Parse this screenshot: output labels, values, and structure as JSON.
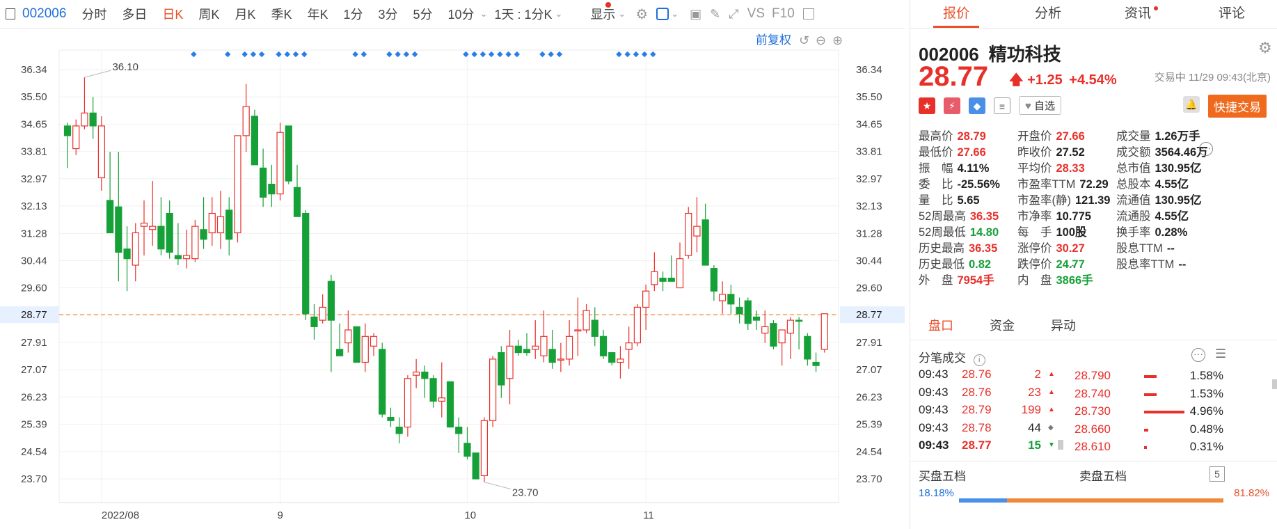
{
  "toolbar": {
    "code": "002006",
    "items": [
      "分时",
      "多日",
      "日K",
      "周K",
      "月K",
      "季K",
      "年K",
      "1分",
      "3分",
      "5分",
      "10分"
    ],
    "selected": "日K",
    "period_select": "1天 : 1分K",
    "display_select": "显示",
    "vs_label": "VS",
    "f10_label": "F10"
  },
  "chart": {
    "restore_label": "前复权",
    "y_ticks": [
      "36.34",
      "35.50",
      "34.65",
      "33.81",
      "32.97",
      "32.13",
      "31.28",
      "30.44",
      "29.60",
      "28.77",
      "27.91",
      "27.07",
      "26.23",
      "25.39",
      "24.54",
      "23.70"
    ],
    "y_current": "28.77",
    "x_labels": [
      "2022/08",
      "9",
      "10",
      "11"
    ],
    "high_label": "36.10",
    "low_label": "23.70"
  },
  "chart_data": {
    "type": "candlestick",
    "ylim": [
      23.7,
      36.34
    ],
    "current_price": 28.77,
    "candles": [
      [
        34.3,
        34.7,
        33.3,
        34.6,
        0
      ],
      [
        34.6,
        34.8,
        33.7,
        33.9,
        1
      ],
      [
        34.6,
        36.1,
        34.5,
        35.0,
        1
      ],
      [
        35.0,
        35.5,
        34.2,
        34.6,
        0
      ],
      [
        34.6,
        34.9,
        32.6,
        33.0,
        1
      ],
      [
        32.3,
        33.8,
        31.3,
        31.3,
        0
      ],
      [
        32.1,
        33.8,
        29.8,
        30.7,
        0
      ],
      [
        30.8,
        31.5,
        29.5,
        30.5,
        0
      ],
      [
        30.3,
        31.6,
        29.8,
        31.3,
        1
      ],
      [
        31.5,
        32.3,
        30.6,
        31.6,
        1
      ],
      [
        31.4,
        32.9,
        30.9,
        31.5,
        1
      ],
      [
        31.5,
        32.4,
        30.6,
        30.8,
        0
      ],
      [
        31.9,
        32.3,
        30.5,
        30.7,
        0
      ],
      [
        30.6,
        31.6,
        30.3,
        30.5,
        0
      ],
      [
        30.5,
        31.4,
        30.2,
        30.6,
        1
      ],
      [
        30.5,
        31.7,
        30.4,
        31.5,
        1
      ],
      [
        31.4,
        32.4,
        30.8,
        31.1,
        0
      ],
      [
        31.3,
        32.4,
        30.9,
        31.9,
        1
      ],
      [
        31.3,
        32.6,
        30.8,
        31.8,
        1
      ],
      [
        32.0,
        32.4,
        30.6,
        31.1,
        0
      ],
      [
        31.3,
        34.0,
        31.0,
        34.3,
        1
      ],
      [
        34.3,
        35.9,
        33.8,
        35.2,
        1
      ],
      [
        34.9,
        35.1,
        33.4,
        33.4,
        0
      ],
      [
        33.3,
        33.9,
        32.1,
        32.4,
        0
      ],
      [
        32.8,
        33.4,
        32.1,
        32.5,
        0
      ],
      [
        32.5,
        34.7,
        32.3,
        34.4,
        1
      ],
      [
        34.6,
        34.6,
        32.8,
        32.9,
        0
      ],
      [
        32.7,
        33.4,
        32.0,
        31.8,
        0
      ],
      [
        31.9,
        32.0,
        28.6,
        28.8,
        0
      ],
      [
        28.7,
        29.1,
        28.0,
        28.4,
        0
      ],
      [
        29.0,
        29.4,
        28.5,
        28.6,
        1
      ],
      [
        29.8,
        30.0,
        27.0,
        28.6,
        0
      ],
      [
        27.7,
        28.5,
        27.5,
        27.5,
        0
      ],
      [
        27.9,
        28.9,
        27.6,
        28.3,
        1
      ],
      [
        28.4,
        28.4,
        27.5,
        27.3,
        0
      ],
      [
        27.3,
        28.5,
        27.0,
        28.1,
        1
      ],
      [
        28.1,
        28.2,
        27.5,
        27.8,
        1
      ],
      [
        27.7,
        27.9,
        25.6,
        25.7,
        0
      ],
      [
        25.6,
        25.9,
        25.3,
        25.5,
        0
      ],
      [
        25.3,
        25.6,
        24.8,
        25.1,
        0
      ],
      [
        25.3,
        26.9,
        25.0,
        26.8,
        1
      ],
      [
        26.9,
        27.4,
        26.5,
        27.0,
        1
      ],
      [
        27.0,
        27.2,
        26.2,
        26.8,
        0
      ],
      [
        26.8,
        26.9,
        25.9,
        26.1,
        0
      ],
      [
        26.1,
        27.3,
        25.6,
        26.2,
        1
      ],
      [
        26.7,
        26.6,
        25.4,
        25.3,
        0
      ],
      [
        25.3,
        25.6,
        24.5,
        25.1,
        0
      ],
      [
        24.8,
        25.3,
        24.3,
        24.4,
        0
      ],
      [
        24.5,
        24.5,
        23.7,
        23.7,
        0
      ],
      [
        23.8,
        25.6,
        23.6,
        25.5,
        1
      ],
      [
        25.5,
        27.5,
        25.3,
        27.4,
        1
      ],
      [
        27.6,
        27.8,
        26.2,
        26.6,
        0
      ],
      [
        26.8,
        28.3,
        26.0,
        27.8,
        1
      ],
      [
        27.8,
        28.0,
        27.5,
        27.6,
        0
      ],
      [
        27.7,
        28.2,
        27.5,
        27.6,
        0
      ],
      [
        27.7,
        28.6,
        27.4,
        27.8,
        1
      ],
      [
        27.5,
        28.9,
        27.3,
        28.1,
        1
      ],
      [
        27.7,
        28.3,
        27.1,
        27.3,
        0
      ],
      [
        27.4,
        27.9,
        27.0,
        27.4,
        1
      ],
      [
        27.4,
        28.6,
        27.2,
        28.1,
        1
      ],
      [
        28.3,
        29.3,
        27.5,
        28.3,
        1
      ],
      [
        28.9,
        29.1,
        28.2,
        28.3,
        1
      ],
      [
        28.6,
        29.0,
        27.8,
        28.1,
        0
      ],
      [
        28.1,
        28.3,
        27.4,
        27.5,
        0
      ],
      [
        27.6,
        27.6,
        27.2,
        27.3,
        0
      ],
      [
        27.4,
        27.8,
        26.8,
        27.3,
        1
      ],
      [
        27.7,
        28.4,
        27.1,
        27.9,
        1
      ],
      [
        27.9,
        29.1,
        27.8,
        29.0,
        1
      ],
      [
        29.0,
        29.7,
        28.3,
        29.5,
        1
      ],
      [
        29.7,
        30.7,
        29.5,
        30.1,
        1
      ],
      [
        29.8,
        30.1,
        29.5,
        29.9,
        0
      ],
      [
        29.9,
        30.6,
        29.8,
        29.8,
        0
      ],
      [
        29.6,
        31.0,
        29.6,
        30.5,
        1
      ],
      [
        30.6,
        32.1,
        30.5,
        31.9,
        1
      ],
      [
        31.2,
        32.4,
        30.7,
        31.5,
        1
      ],
      [
        31.7,
        32.2,
        30.5,
        30.3,
        0
      ],
      [
        30.2,
        30.3,
        29.2,
        29.5,
        0
      ],
      [
        29.2,
        29.8,
        28.8,
        29.4,
        1
      ],
      [
        29.4,
        29.7,
        28.8,
        29.1,
        0
      ],
      [
        28.8,
        29.3,
        28.5,
        29.0,
        0
      ],
      [
        29.2,
        29.3,
        28.3,
        28.5,
        0
      ],
      [
        28.7,
        28.9,
        28.3,
        28.6,
        0
      ],
      [
        28.4,
        28.9,
        27.9,
        28.2,
        1
      ],
      [
        28.5,
        28.6,
        27.7,
        27.8,
        0
      ],
      [
        27.9,
        28.3,
        27.2,
        28.3,
        1
      ],
      [
        28.2,
        28.7,
        27.4,
        28.6,
        1
      ],
      [
        28.6,
        28.7,
        27.7,
        28.6,
        0
      ],
      [
        28.1,
        28.2,
        27.2,
        27.4,
        0
      ],
      [
        27.3,
        27.6,
        27.0,
        27.2,
        0
      ],
      [
        27.7,
        28.8,
        27.6,
        28.8,
        1
      ]
    ]
  },
  "tabs": [
    "报价",
    "分析",
    "资讯",
    "评论"
  ],
  "stock": {
    "code": "002006",
    "name": "精功科技",
    "price": "28.77",
    "change": "+1.25",
    "change_pct": "+4.54%",
    "status": "交易中 11/29 09:43(北京)",
    "watch_label": "自选",
    "quick_trade": "快捷交易"
  },
  "stats": [
    [
      "最高价",
      "28.79",
      "r"
    ],
    [
      "开盘价",
      "27.66",
      "r"
    ],
    [
      "成交量",
      "1.26万手",
      "k"
    ],
    [
      "最低价",
      "27.66",
      "r"
    ],
    [
      "昨收价",
      "27.52",
      "k"
    ],
    [
      "成交额",
      "3564.46万",
      "k"
    ],
    [
      "振　幅",
      "4.11%",
      "k"
    ],
    [
      "平均价",
      "28.33",
      "r"
    ],
    [
      "总市值",
      "130.95亿",
      "k"
    ],
    [
      "委　比",
      "-25.56%",
      "k"
    ],
    [
      "市盈率TTM",
      "72.29",
      "k"
    ],
    [
      "总股本",
      "4.55亿",
      "k"
    ],
    [
      "量　比",
      "5.65",
      "k"
    ],
    [
      "市盈率(静)",
      "121.39",
      "k"
    ],
    [
      "流通值",
      "130.95亿",
      "k"
    ],
    [
      "52周最高",
      "36.35",
      "r"
    ],
    [
      "市净率",
      "10.775",
      "k"
    ],
    [
      "流通股",
      "4.55亿",
      "k"
    ],
    [
      "52周最低",
      "14.80",
      "g"
    ],
    [
      "每　手",
      "100股",
      "k"
    ],
    [
      "换手率",
      "0.28%",
      "k"
    ],
    [
      "历史最高",
      "36.35",
      "r"
    ],
    [
      "涨停价",
      "30.27",
      "r"
    ],
    [
      "股息TTM",
      "--",
      "k"
    ],
    [
      "历史最低",
      "0.82",
      "g"
    ],
    [
      "跌停价",
      "24.77",
      "g"
    ],
    [
      "股息率TTM",
      "--",
      "k"
    ],
    [
      "外　盘",
      "7954手",
      "r"
    ],
    [
      "内　盘",
      "3866手",
      "g"
    ],
    [
      "",
      ""
    ]
  ],
  "subtabs": [
    "盘口",
    "资金",
    "异动"
  ],
  "ticks_title": "分笔成交",
  "ticks": [
    {
      "time": "09:43",
      "price": "28.76",
      "vol": "2",
      "dir": "up"
    },
    {
      "time": "09:43",
      "price": "28.76",
      "vol": "23",
      "dir": "up"
    },
    {
      "time": "09:43",
      "price": "28.79",
      "vol": "199",
      "dir": "up"
    },
    {
      "time": "09:43",
      "price": "28.78",
      "vol": "44",
      "dir": "flat"
    },
    {
      "time": "09:43",
      "price": "28.77",
      "vol": "15",
      "dir": "down"
    }
  ],
  "dist": [
    {
      "price": "28.790",
      "pct": "1.58%"
    },
    {
      "price": "28.740",
      "pct": "1.53%"
    },
    {
      "price": "28.730",
      "pct": "4.96%"
    },
    {
      "price": "28.660",
      "pct": "0.48%"
    },
    {
      "price": "28.610",
      "pct": "0.31%"
    }
  ],
  "buy_title": "买盘五档",
  "sell_title": "卖盘五档",
  "level_count": "5",
  "buy_pct": "18.18%",
  "sell_pct": "81.82%",
  "colors": {
    "up": "#e8302a",
    "down": "#16a038",
    "accent": "#e8502a",
    "link": "#1e6fd9"
  }
}
